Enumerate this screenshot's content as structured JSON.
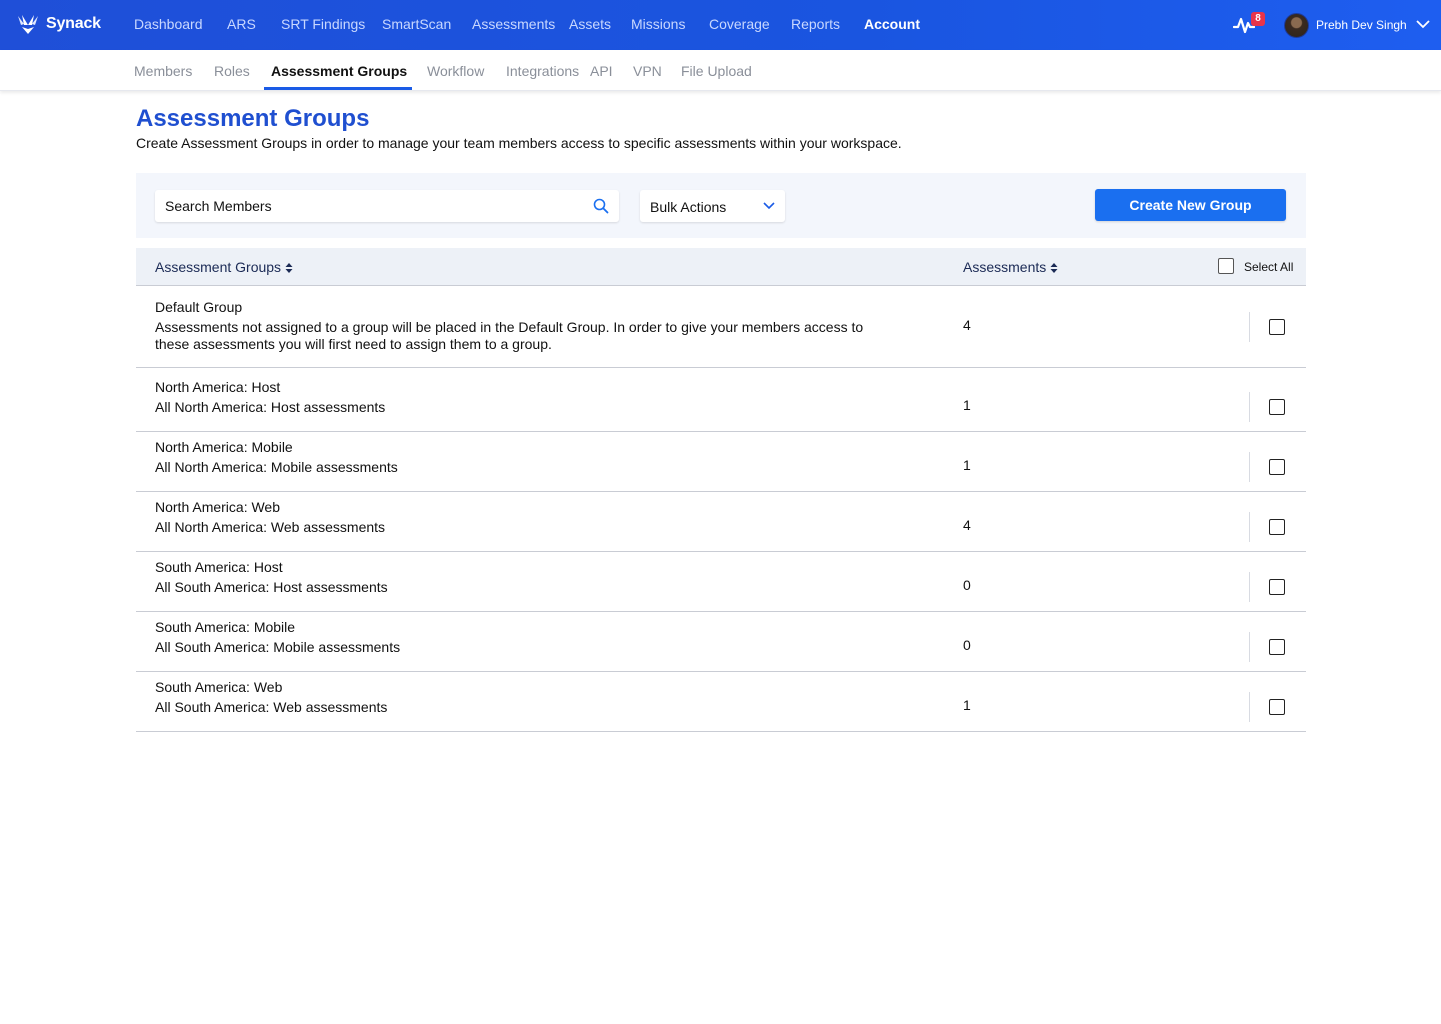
{
  "app": {
    "logo_text": "Synack"
  },
  "top_nav": [
    {
      "label": "Dashboard",
      "active": false
    },
    {
      "label": "ARS",
      "active": false
    },
    {
      "label": "SRT Findings",
      "active": false
    },
    {
      "label": "SmartScan",
      "active": false
    },
    {
      "label": "Assessments",
      "active": false
    },
    {
      "label": "Assets",
      "active": false
    },
    {
      "label": "Missions",
      "active": false
    },
    {
      "label": "Coverage",
      "active": false
    },
    {
      "label": "Reports",
      "active": false
    },
    {
      "label": "Account",
      "active": true
    }
  ],
  "notifications": {
    "count": "8"
  },
  "user": {
    "name": "Prebh Dev Singh"
  },
  "sub_nav": [
    {
      "label": "Members",
      "active": false
    },
    {
      "label": "Roles",
      "active": false
    },
    {
      "label": "Assessment Groups",
      "active": true
    },
    {
      "label": "Workflow",
      "active": false
    },
    {
      "label": "Integrations",
      "active": false
    },
    {
      "label": "API",
      "active": false
    },
    {
      "label": "VPN",
      "active": false
    },
    {
      "label": "File Upload",
      "active": false
    }
  ],
  "page": {
    "title": "Assessment Groups",
    "description": "Create Assessment Groups in order to manage your team members access to specific assessments within your workspace."
  },
  "toolbar": {
    "search_placeholder": "Search Members",
    "bulk_actions_label": "Bulk Actions",
    "create_button_label": "Create New Group"
  },
  "table": {
    "columns": {
      "groups": "Assessment Groups",
      "assessments": "Assessments",
      "select_all": "Select All"
    },
    "rows": [
      {
        "name": "Default Group",
        "description": "Assessments not assigned to a group will be placed in the Default Group. In order to give your members access to these assessments you will first need to assign them to a group.",
        "count": "4"
      },
      {
        "name": "North America: Host",
        "description": "All North America: Host assessments",
        "count": "1"
      },
      {
        "name": "North America: Mobile",
        "description": "All North America: Mobile assessments",
        "count": "1"
      },
      {
        "name": "North America: Web",
        "description": "All North America: Web assessments",
        "count": "4"
      },
      {
        "name": "South America: Host",
        "description": "All South America: Host assessments",
        "count": "0"
      },
      {
        "name": "South America: Mobile",
        "description": "All South America: Mobile assessments",
        "count": "0"
      },
      {
        "name": "South America: Web",
        "description": "All South America: Web assessments",
        "count": "1"
      }
    ]
  },
  "colors": {
    "brand_blue": "#1f4fd8",
    "primary_button": "#1a6ff0",
    "title_blue": "#1f4fd0",
    "badge_red": "#e8344a"
  }
}
